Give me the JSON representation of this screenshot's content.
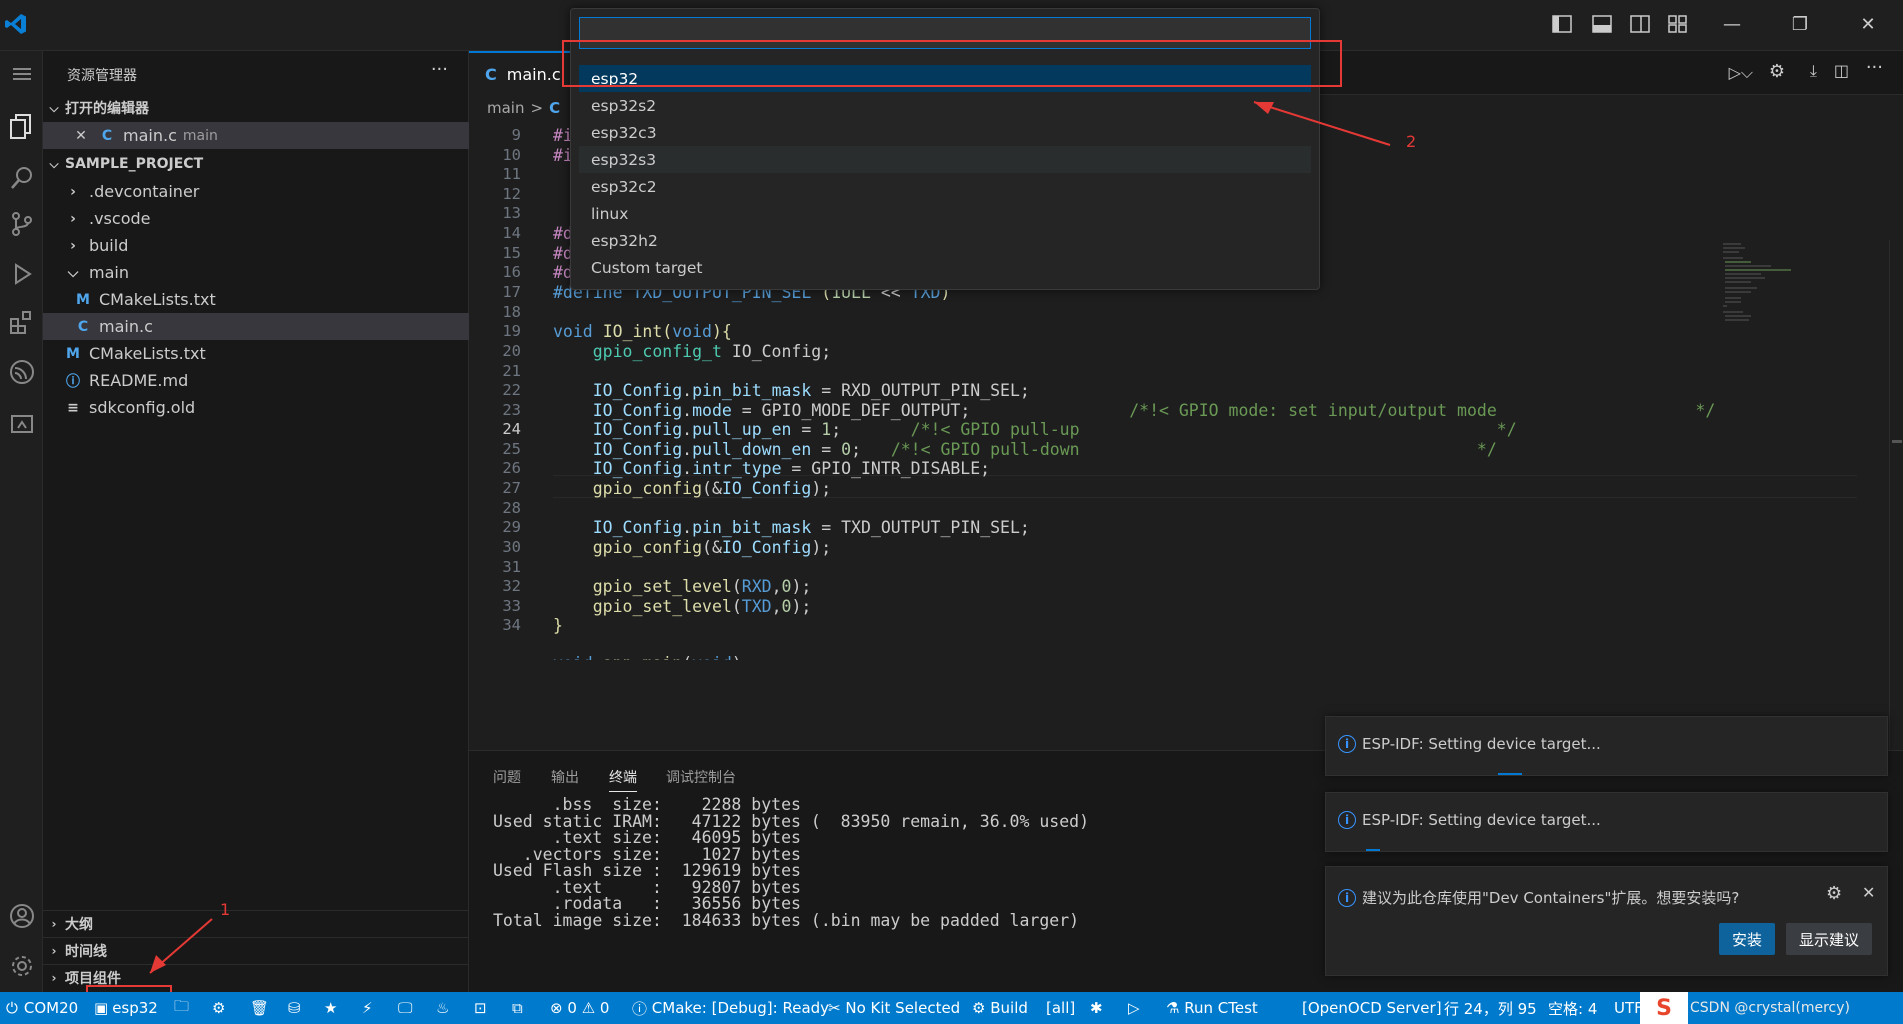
{
  "titlebar": {
    "search_placeholder": ""
  },
  "explorer": {
    "title": "资源管理器",
    "more": "···",
    "open_editors_header": "打开的编辑器",
    "open_editor": {
      "name": "main.c",
      "desc": "main"
    },
    "project_header": "SAMPLE_PROJECT",
    "tree": [
      ".devcontainer",
      ".vscode",
      "build",
      "main",
      "CMakeLists.txt",
      "main.c",
      "CMakeLists.txt",
      "README.md",
      "sdkconfig.old"
    ],
    "outline_header": "大纲",
    "timeline_header": "时间线",
    "components_header": "项目组件"
  },
  "editor": {
    "tab_label": "main.c",
    "breadcrumb_folder": "main",
    "breadcrumb_sep": ">",
    "breadcrumb_file_icon": "C",
    "line_numbers": [
      "9",
      "10",
      "11",
      "12",
      "13",
      "14",
      "15",
      "16",
      "17",
      "18",
      "19",
      "20",
      "21",
      "22",
      "23",
      "24",
      "25",
      "26",
      "27",
      "28",
      "29",
      "30",
      "31",
      "32",
      "33",
      "34"
    ],
    "current_line": "24"
  },
  "quick_pick": {
    "input_value": "",
    "items": [
      "esp32",
      "esp32s2",
      "esp32c3",
      "esp32s3",
      "esp32c2",
      "linux",
      "esp32h2",
      "Custom target"
    ]
  },
  "annotations": {
    "one": "1",
    "two": "2"
  },
  "panel": {
    "tabs": [
      "问题",
      "输出",
      "终端",
      "调试控制台"
    ],
    "terminal_lines": [
      "      .bss  size:    2288 bytes",
      "Used static IRAM:   47122 bytes (  83950 remain, 36.0% used)",
      "      .text size:   46095 bytes",
      "   .vectors size:    1027 bytes",
      "Used Flash size :  129619 bytes",
      "      .text     :   92807 bytes",
      "      .rodata   :   36556 bytes",
      "Total image size:  184633 bytes (.bin may be padded larger)"
    ]
  },
  "notifications": [
    {
      "text": "ESP-IDF: Setting device target..."
    },
    {
      "text": "ESP-IDF: Setting device target..."
    },
    {
      "text": "建议为此仓库使用\"Dev Containers\"扩展。想要安装吗?",
      "primary": "安装",
      "secondary": "显示建议"
    }
  ],
  "statusbar": {
    "port": "COM20",
    "target": "esp32",
    "problems": "0",
    "warnings": "0",
    "cmake": "CMake: [Debug]: Ready",
    "kit": "No Kit Selected",
    "build": "Build",
    "build_target": "[all]",
    "ctest": "Run CTest",
    "openocd": "[OpenOCD Server]",
    "cursor": "行 24，列 95",
    "spaces": "空格: 4",
    "encoding": "UTF",
    "watermark": "CSDN @crystal(mercy)"
  },
  "colors": {
    "accent": "#007acc",
    "highlight": "#04395e",
    "annotation_red": "#e53935"
  }
}
